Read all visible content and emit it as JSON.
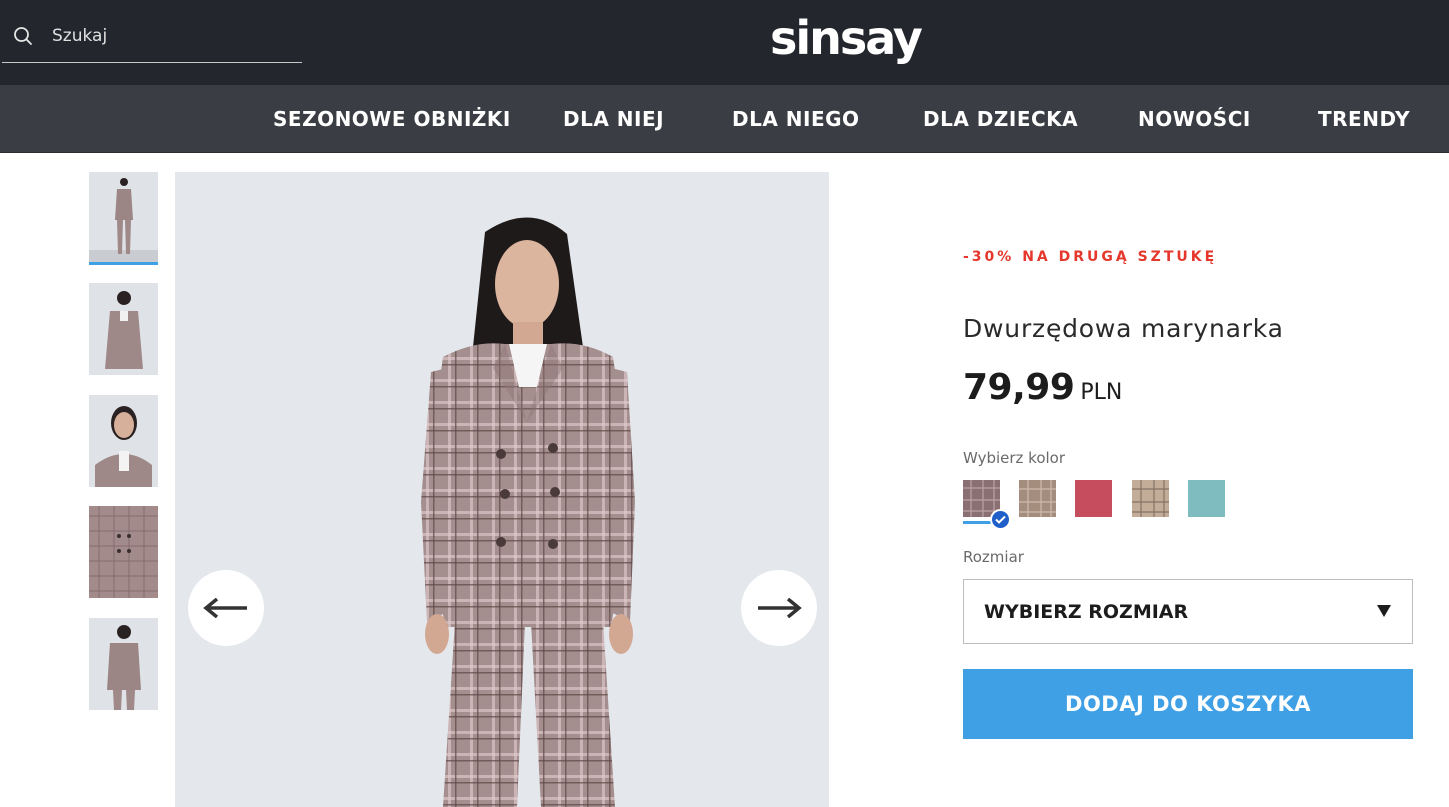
{
  "header": {
    "search": {
      "placeholder": "Szukaj",
      "value": ""
    },
    "logo": "sinsay"
  },
  "nav": {
    "items": [
      {
        "label": "SEZONOWE OBNIŻKI"
      },
      {
        "label": "DLA NIEJ"
      },
      {
        "label": "DLA NIEGO"
      },
      {
        "label": "DLA DZIECKA"
      },
      {
        "label": "NOWOŚCI"
      },
      {
        "label": "TRENDY"
      }
    ]
  },
  "gallery": {
    "thumbnail_count": 5,
    "selected_index": 0
  },
  "product": {
    "promo": "-30% NA DRUGĄ SZTUKĘ",
    "title": "Dwurzędowa marynarka",
    "price": "79,99",
    "currency": "PLN",
    "color_label": "Wybierz kolor",
    "colors": [
      {
        "name": "brown-check",
        "hex": "#8a6f73",
        "selected": true
      },
      {
        "name": "beige-check",
        "hex": "#a58d7e",
        "selected": false
      },
      {
        "name": "red",
        "hex": "#c64d5e",
        "selected": false
      },
      {
        "name": "light-check",
        "hex": "#c3ad98",
        "selected": false
      },
      {
        "name": "teal",
        "hex": "#7fbcc0",
        "selected": false
      }
    ],
    "size_label": "Rozmiar",
    "size_select": "WYBIERZ ROZMIAR",
    "add_to_cart": "DODAJ DO KOSZYKA"
  },
  "colors": {
    "topbar": "#23262c",
    "navbar": "#3a3d43",
    "accent": "#3fa0e5",
    "promo": "#e5372b"
  }
}
